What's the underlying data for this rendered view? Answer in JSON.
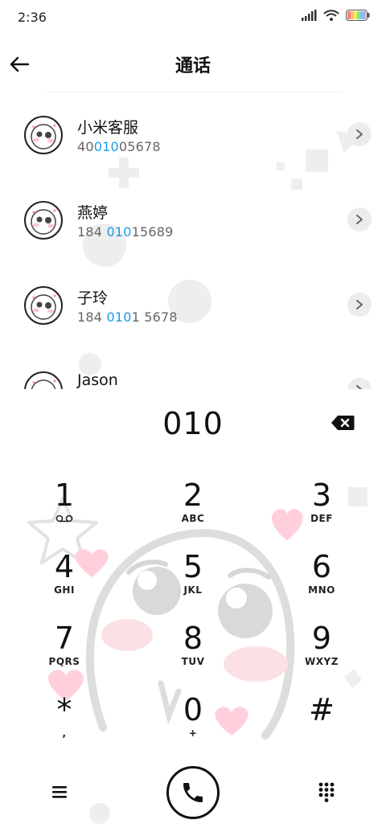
{
  "status_bar": {
    "time": "2:36",
    "icons": [
      "signal-icon",
      "wifi-icon",
      "battery-icon"
    ]
  },
  "header": {
    "title": "通话",
    "back_icon": "back-arrow-icon"
  },
  "contacts": [
    {
      "name": "小米客服",
      "number_pre": "40",
      "number_match": "010",
      "number_post": "05678"
    },
    {
      "name": "燕婷",
      "number_pre": "184 ",
      "number_match": "010",
      "number_post": "15689"
    },
    {
      "name": "子玲",
      "number_pre": "184 ",
      "number_match": "010",
      "number_post": "1 5678"
    },
    {
      "name": "Jason",
      "number_pre": "",
      "number_match": "",
      "number_post": ""
    }
  ],
  "dialer": {
    "input_value": "010",
    "keys": [
      {
        "digit": "1",
        "letters": "",
        "icon": "voicemail-icon"
      },
      {
        "digit": "2",
        "letters": "ABC"
      },
      {
        "digit": "3",
        "letters": "DEF"
      },
      {
        "digit": "4",
        "letters": "GHI"
      },
      {
        "digit": "5",
        "letters": "JKL"
      },
      {
        "digit": "6",
        "letters": "MNO"
      },
      {
        "digit": "7",
        "letters": "PQRS"
      },
      {
        "digit": "8",
        "letters": "TUV"
      },
      {
        "digit": "9",
        "letters": "WXYZ"
      },
      {
        "digit": "*",
        "letters": ","
      },
      {
        "digit": "0",
        "letters": "+"
      },
      {
        "digit": "#",
        "letters": ""
      }
    ]
  },
  "bottom_bar": {
    "left_icon": "menu-icon",
    "center_icon": "phone-icon",
    "right_icon": "dialpad-icon"
  },
  "colors": {
    "highlight": "#1a9be6",
    "heart": "#ffc6d4",
    "deco_gray": "#e8e8e8"
  }
}
